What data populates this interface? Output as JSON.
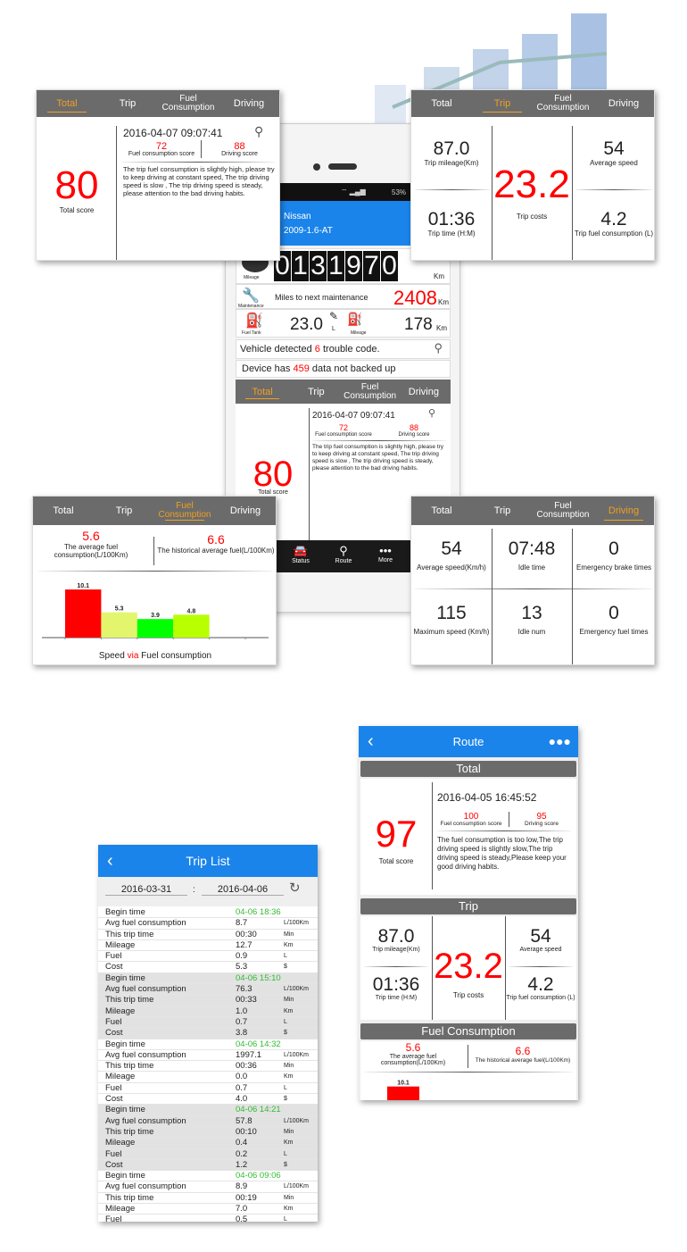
{
  "colors": {
    "accent_blue": "#1b84ea",
    "tab_bar": "#6b6b6b",
    "active_tab": "#f0a020",
    "highlight_red": "#ff0000",
    "time_green": "#33bb33"
  },
  "tabs": [
    "Total",
    "Trip",
    "Fuel Consumption",
    "Driving"
  ],
  "total_card": {
    "active_tab": "Total",
    "score": "80",
    "score_label": "Total score",
    "datetime": "2016-04-07 09:07:41",
    "fuel_score": "72",
    "fuel_score_label": "Fuel consumption score",
    "driving_score": "88",
    "driving_score_label": "Driving score",
    "message": "The trip fuel consumption is slightly high, please try to keep driving at constant speed, The trip driving speed is slow , The trip driving speed is steady, please attention to the bad driving habits.",
    "search_icon": "search-icon"
  },
  "trip_card": {
    "active_tab": "Trip",
    "mileage": "87.0",
    "mileage_label": "Trip mileage(Km)",
    "time": "01:36",
    "time_label": "Trip time (H:M)",
    "cost": "23.2",
    "cost_label": "Trip costs",
    "avg_speed": "54",
    "avg_speed_label": "Average speed",
    "fuel": "4.2",
    "fuel_label": "Trip fuel consumption (L)"
  },
  "fuel_card": {
    "active_tab": "Fuel Consumption",
    "avg": "5.6",
    "avg_label": "The average fuel consumption(L/100Km)",
    "hist": "6.6",
    "hist_label": "The historical average fuel(L/100Km)",
    "caption_left": "Speed",
    "caption_mid": "via",
    "caption_right": "Fuel consumption"
  },
  "driving_card": {
    "active_tab": "Driving",
    "items": [
      {
        "value": "54",
        "label": "Average speed(Km/h)"
      },
      {
        "value": "07:48",
        "label": "Idle time"
      },
      {
        "value": "0",
        "label": "Emergency brake times"
      },
      {
        "value": "115",
        "label": "Maximum speed (Km/h)"
      },
      {
        "value": "13",
        "label": "Idle num"
      },
      {
        "value": "0",
        "label": "Emergency fuel times"
      }
    ]
  },
  "phone": {
    "battery": "53%",
    "car_make": "Nissan",
    "car_model": "2009-1.6-AT",
    "odometer": [
      "0",
      "1",
      "3",
      "1",
      "9",
      "7",
      "0"
    ],
    "odometer_unit": "Km",
    "mileage_label": "Mileage",
    "maintenance_label": "Maintenance",
    "maintenance_text": "Miles to next maintenance",
    "maintenance_value": "2408",
    "maintenance_unit": "Km",
    "fuel_tank_label": "Fuel Tank",
    "fuel_value": "23.0",
    "fuel_unit": "L",
    "range_label": "Mileage",
    "range_value": "178",
    "range_unit": "Km",
    "trouble_prefix": "Vehicle detected",
    "trouble_count": "6",
    "trouble_suffix": "trouble code.",
    "backup_prefix": "Device has",
    "backup_count": "459",
    "backup_suffix": "data not backed up",
    "active_tab": "Total",
    "nav": [
      "Status",
      "Route",
      "More"
    ]
  },
  "trip_list": {
    "title": "Trip List",
    "date_from": "2016-03-31",
    "date_sep": ":",
    "date_to": "2016-04-06",
    "labels": [
      "Begin time",
      "Avg fuel consumption",
      "This trip time",
      "Mileage",
      "Fuel",
      "Cost"
    ],
    "units": [
      "",
      "L/100Km",
      "Min",
      "Km",
      "L",
      "$"
    ],
    "groups": [
      [
        "04-06 18:36",
        "8.7",
        "00:30",
        "12.7",
        "0.9",
        "5.3"
      ],
      [
        "04-06 15:10",
        "76.3",
        "00:33",
        "1.0",
        "0.7",
        "3.8"
      ],
      [
        "04-06 14:32",
        "1997.1",
        "00:36",
        "0.0",
        "0.7",
        "4.0"
      ],
      [
        "04-06 14:21",
        "57.8",
        "00:10",
        "0.4",
        "0.2",
        "1.2"
      ],
      [
        "04-06 09:06",
        "8.9",
        "00:19",
        "7.0",
        "0.5",
        ""
      ]
    ]
  },
  "route": {
    "title": "Route",
    "total_section": "Total",
    "trip_section": "Trip",
    "fuel_section": "Fuel Consumption",
    "score": "97",
    "score_label": "Total score",
    "datetime": "2016-04-05 16:45:52",
    "fuel_score": "100",
    "fuel_score_label": "Fuel consumption score",
    "driving_score": "95",
    "driving_score_label": "Driving score",
    "message": "The fuel consumption is too low,The trip driving speed is slightly slow,The trip driving speed is steady,Please keep your good driving habits.",
    "mileage": "87.0",
    "mileage_label": "Trip mileage(Km)",
    "time": "01:36",
    "time_label": "Trip time (H:M)",
    "cost": "23.2",
    "cost_label": "Trip costs",
    "avg_speed": "54",
    "avg_speed_label": "Average speed",
    "fuel": "4.2",
    "fuel_label": "Trip fuel consumption (L)",
    "avg": "5.6",
    "avg_label": "The average fuel consumption(L/100Km)",
    "hist": "6.6",
    "hist_label": "The historical average fuel(L/100Km)"
  },
  "chart_data": [
    {
      "type": "bar",
      "title": "",
      "xlabel": "Speed via Fuel consumption",
      "ylabel": "",
      "x_edges": [
        0,
        30,
        60,
        90,
        120
      ],
      "values": [
        10.1,
        5.3,
        3.9,
        4.8
      ],
      "xticks": [
        "0",
        "30",
        "60",
        "90",
        "120",
        "150"
      ],
      "xlim": [
        0,
        150
      ],
      "ylim": [
        0,
        12
      ],
      "bar_colors": [
        "#ff0000",
        "#e2f56c",
        "#00ff00",
        "#b8ff00"
      ],
      "grid": false
    }
  ]
}
